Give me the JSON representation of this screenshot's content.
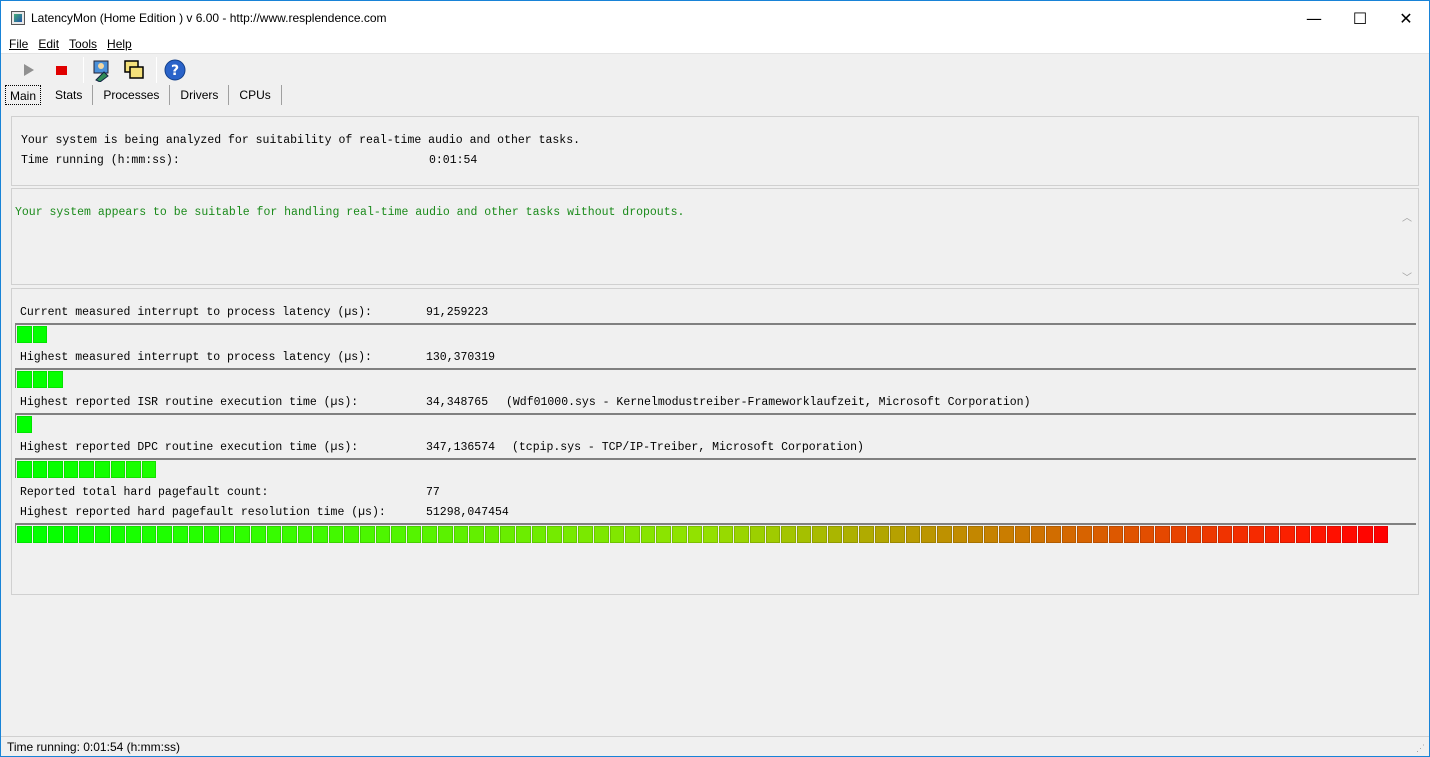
{
  "window": {
    "title": "LatencyMon  (Home Edition )  v 6.00 - http://www.resplendence.com",
    "controls": {
      "minimize": "—",
      "maximize": "☐",
      "close": "✕"
    }
  },
  "menu": {
    "file": "File",
    "edit": "Edit",
    "tools": "Tools",
    "help": "Help"
  },
  "toolbar": {
    "icons": [
      "play-icon",
      "stop-icon",
      "user-settings-icon",
      "windows-icon",
      "help-icon"
    ]
  },
  "tabs": [
    "Main",
    "Stats",
    "Processes",
    "Drivers",
    "CPUs"
  ],
  "analysis": {
    "line1": "Your system is being analyzed for suitability of real-time audio and other tasks.",
    "time_label": "Time running (h:mm:ss):",
    "time_value": "0:01:54"
  },
  "message": {
    "text": "Your system appears to be suitable for handling real-time audio and other tasks without dropouts.",
    "color": "#1a8a1a"
  },
  "stats": {
    "current_latency_label": "Current measured interrupt to process latency (µs):",
    "current_latency_value": "91,259223",
    "current_latency_segments": 2,
    "highest_latency_label": "Highest measured interrupt to process latency (µs):",
    "highest_latency_value": "130,370319",
    "highest_latency_segments": 3,
    "isr_label": "Highest reported ISR routine execution time (µs):",
    "isr_value": "34,348765",
    "isr_detail": "(Wdf01000.sys - Kernelmodustreiber-Frameworklaufzeit, Microsoft Corporation)",
    "isr_segments": 1,
    "dpc_label": "Highest reported DPC routine execution time (µs):",
    "dpc_value": "347,136574",
    "dpc_detail": "(tcpip.sys - TCP/IP-Treiber, Microsoft Corporation)",
    "dpc_segments": 9,
    "pagefault_count_label": "Reported total hard pagefault count:",
    "pagefault_count_value": "77",
    "pagefault_time_label": "Highest reported hard pagefault resolution time (µs):",
    "pagefault_time_value": "51298,047454",
    "pagefault_time_segments": 88
  },
  "status_bar": {
    "text": "Time running: 0:01:54  (h:mm:ss)"
  },
  "colors": {
    "bar_start": "#00ff00",
    "bar_end": "#ff0000"
  }
}
